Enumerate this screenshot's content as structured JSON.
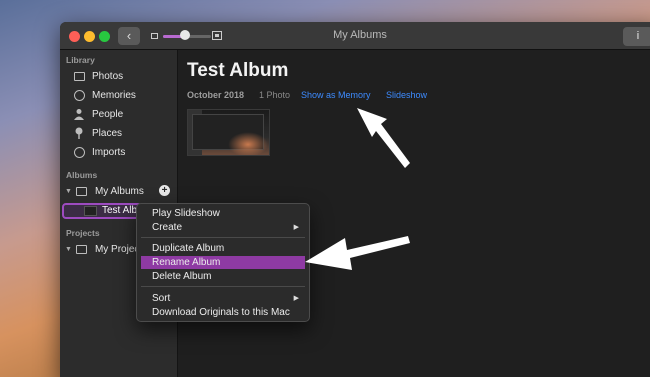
{
  "window": {
    "title": "My Albums",
    "info_label": "i"
  },
  "toolbar": {
    "back_label": "‹"
  },
  "sidebar": {
    "library_header": "Library",
    "library_items": [
      {
        "label": "Photos",
        "icon": "photos-icon"
      },
      {
        "label": "Memories",
        "icon": "memories-icon"
      },
      {
        "label": "People",
        "icon": "people-icon"
      },
      {
        "label": "Places",
        "icon": "places-icon"
      },
      {
        "label": "Imports",
        "icon": "imports-icon"
      }
    ],
    "albums_header": "Albums",
    "my_albums_label": "My Albums",
    "selected_album_label": "Test Album",
    "projects_header": "Projects",
    "my_projects_label": "My Projects"
  },
  "main": {
    "album_title": "Test Album",
    "date": "October 2018",
    "photo_count": "1 Photo",
    "show_as_memory": "Show as Memory",
    "slideshow": "Slideshow"
  },
  "context_menu": {
    "items": [
      {
        "label": "Play Slideshow"
      },
      {
        "label": "Create"
      },
      {
        "label": "Duplicate Album"
      },
      {
        "label": "Rename Album"
      },
      {
        "label": "Delete Album"
      },
      {
        "label": "Sort"
      },
      {
        "label": "Download Originals to this Mac"
      }
    ],
    "highlighted": "Rename Album"
  },
  "colors": {
    "accent_purple": "#8e3aa3",
    "link_blue": "#3d8bff",
    "annotation_arrow": "#ffffff"
  }
}
